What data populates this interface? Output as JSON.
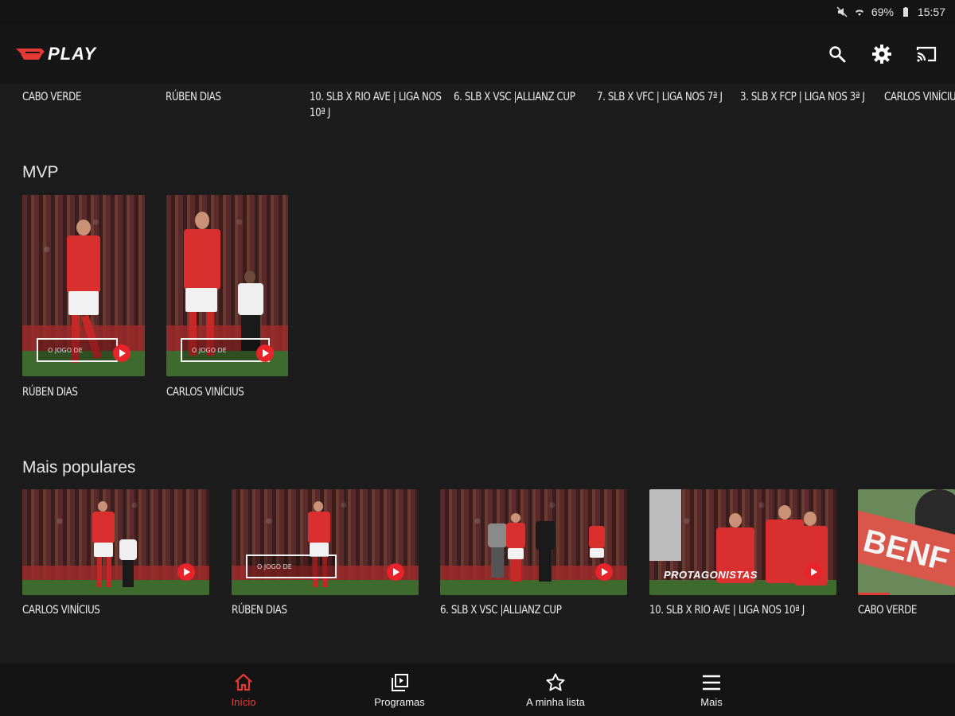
{
  "status": {
    "battery": "69%",
    "time": "15:57"
  },
  "app": {
    "logo_text": "PLAY",
    "brand_color": "#e53935"
  },
  "header": {
    "actions": [
      {
        "name": "search-icon"
      },
      {
        "name": "settings-gear-icon"
      },
      {
        "name": "cast-icon"
      }
    ]
  },
  "top_row": {
    "items": [
      "CABO VERDE",
      "RÚBEN DIAS",
      "10. SLB X RIO AVE | LIGA NOS 10ª J",
      "6. SLB X VSC |ALLIANZ CUP",
      "7. SLB X VFC |  LIGA NOS 7ª J",
      "3. SLB X FCP | LIGA NOS 3ª J",
      "CARLOS VINÍCIUS"
    ]
  },
  "mvp": {
    "title": "MVP",
    "tag_text": "O JOGO DE",
    "items": [
      "RÚBEN DIAS",
      "CARLOS VINÍCIUS"
    ]
  },
  "popular": {
    "title": "Mais populares",
    "tag_text": "O JOGO DE",
    "overlay_text": "PROTAGONISTAS",
    "banner_text": "BENF",
    "items": [
      "CARLOS VINÍCIUS",
      "RÚBEN DIAS",
      "6. SLB X VSC |ALLIANZ CUP",
      "10. SLB X RIO AVE | LIGA NOS 10ª J",
      "CABO VERDE"
    ]
  },
  "bottom_nav": {
    "items": [
      {
        "label": "Início",
        "icon": "home-icon",
        "active": true
      },
      {
        "label": "Programas",
        "icon": "programs-icon",
        "active": false
      },
      {
        "label": "A minha lista",
        "icon": "star-icon",
        "active": false
      },
      {
        "label": "Mais",
        "icon": "menu-icon",
        "active": false
      }
    ]
  }
}
